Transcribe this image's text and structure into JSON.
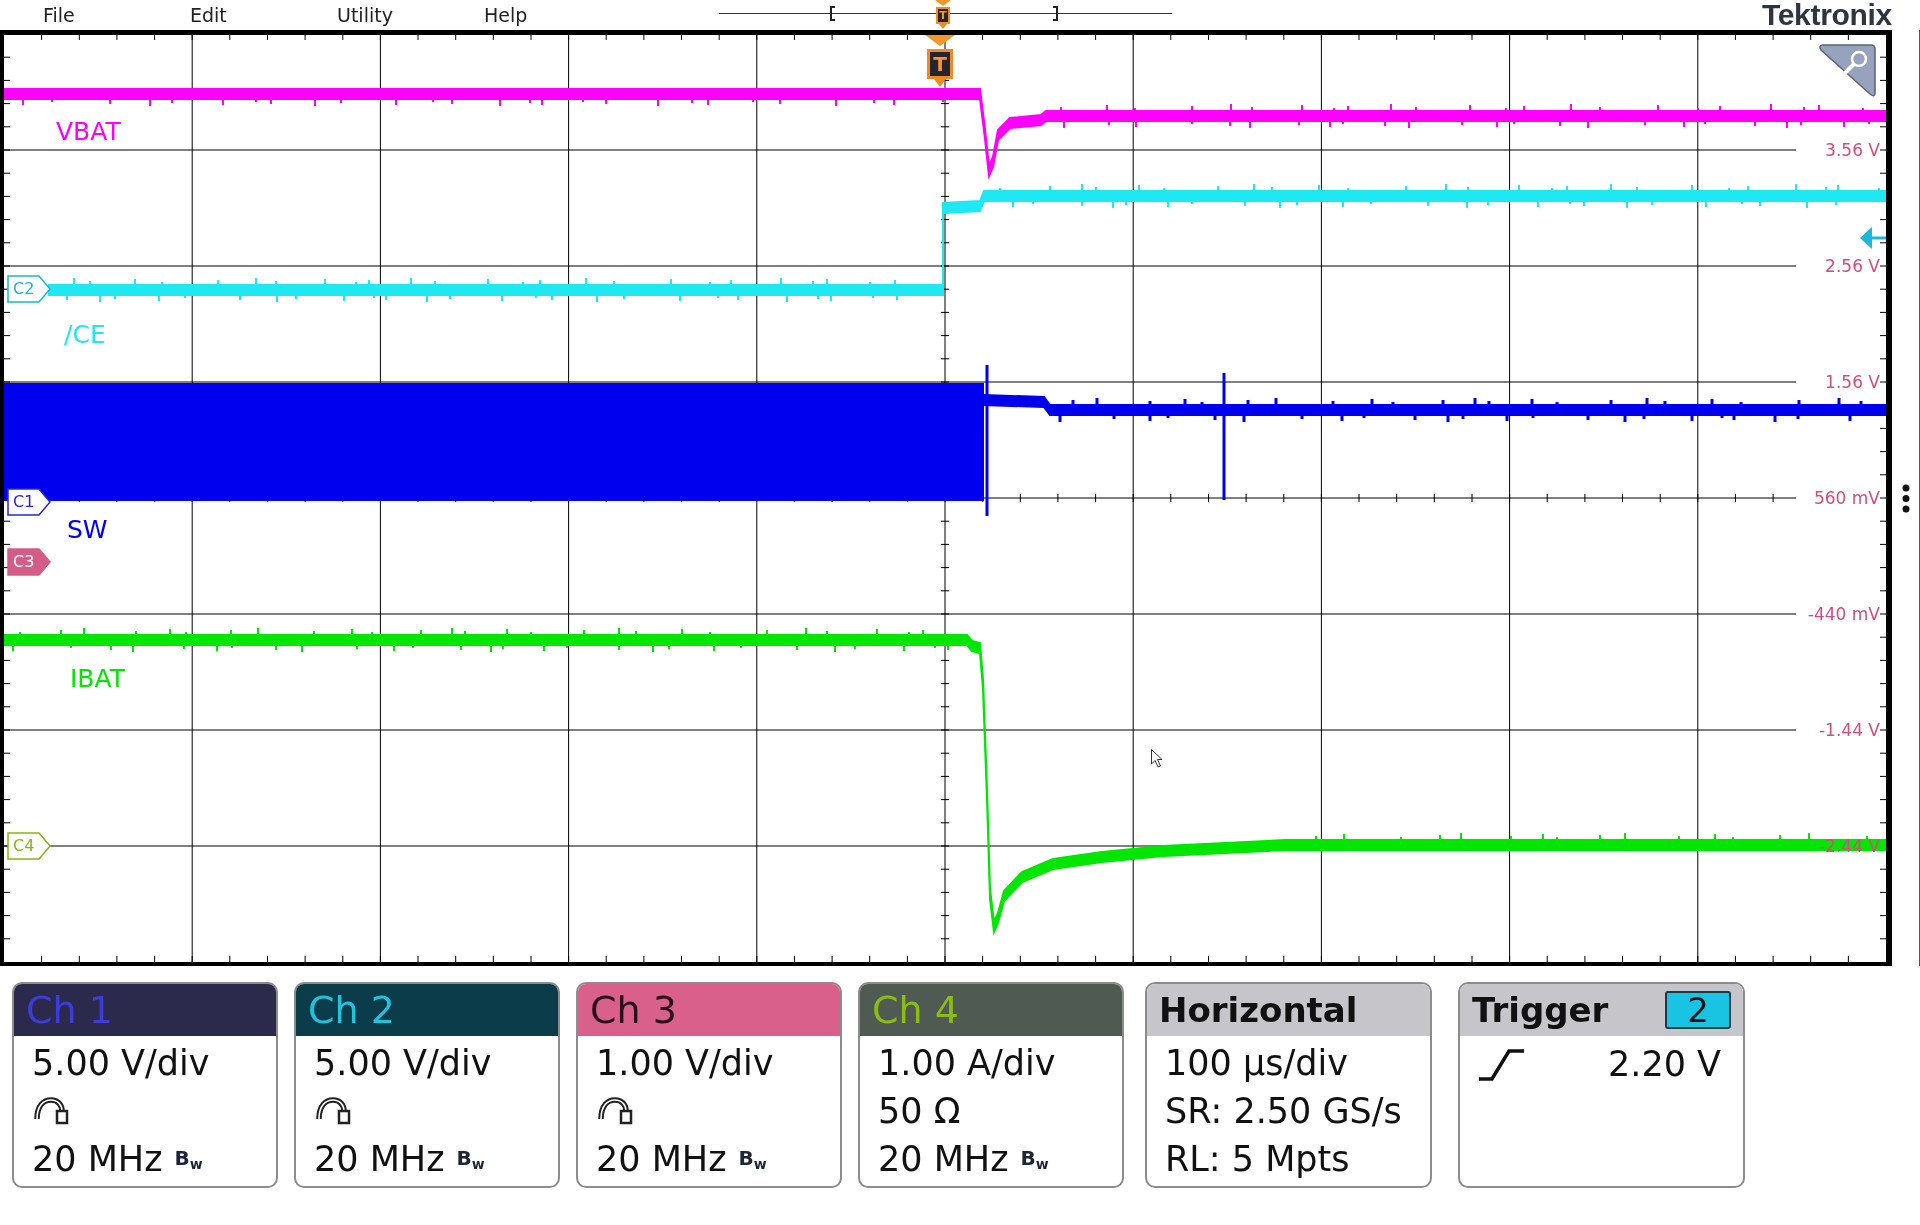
{
  "menu": [
    "File",
    "Edit",
    "Utility",
    "Help"
  ],
  "record_view": {
    "trigger_label": "T"
  },
  "logo": "Tektronix",
  "display": {
    "trigger_label": "T",
    "traces": [
      {
        "label": "VBAT",
        "kind": "sag",
        "color": "#ff00ff"
      },
      {
        "label": "/CE",
        "kind": "rise",
        "color": "#1ee8f2"
      },
      {
        "label": "SW",
        "kind": "burst",
        "color": "#0000ee"
      },
      {
        "label": "IBAT",
        "kind": "dip",
        "color": "#00e600"
      }
    ],
    "channel_markers": [
      {
        "label": "C2",
        "color": "#1cb4d8",
        "selected": false
      },
      {
        "label": "C1",
        "color": "#2828d0",
        "selected": false
      },
      {
        "label": "C3",
        "color": "#d65c88",
        "selected": true
      },
      {
        "label": "C4",
        "color": "#86b41a",
        "selected": false
      }
    ],
    "scale_labels": [
      "3.56 V",
      "2.56 V",
      "1.56 V",
      "560 mV",
      "-440 mV",
      "-1.44 V",
      "-2.44 V"
    ]
  },
  "channels": [
    {
      "label": "Ch 1",
      "color": "#2b2a4c",
      "rows": [
        {
          "kind": "scale",
          "text": "5.00 V/div"
        },
        {
          "kind": "probe"
        },
        {
          "kind": "bandwidth",
          "text": "20 MHz",
          "mark": "B$_{w}$"
        }
      ]
    },
    {
      "label": "Ch 2",
      "color": "#0a3c4a",
      "rows": [
        {
          "kind": "scale",
          "text": "5.00 V/div"
        },
        {
          "kind": "probe"
        },
        {
          "kind": "bandwidth",
          "text": "20 MHz",
          "mark": "B$_{w}$"
        }
      ]
    },
    {
      "label": "Ch 3",
      "color": "#d8608a",
      "rows": [
        {
          "kind": "scale",
          "text": "1.00 V/div"
        },
        {
          "kind": "probe"
        },
        {
          "kind": "bandwidth",
          "text": "20 MHz",
          "mark": "B$_{w}$"
        }
      ]
    },
    {
      "label": "Ch 4",
      "color": "#4f5b52",
      "rows": [
        {
          "kind": "scale",
          "text": "1.00 A/div"
        },
        {
          "kind": "termination",
          "text": "50 Ω"
        },
        {
          "kind": "bandwidth",
          "text": "20 MHz",
          "mark": "B$_{w}$"
        }
      ]
    }
  ],
  "horizontal": {
    "title": "Horizontal",
    "rows": [
      "100 µs/div",
      "SR: 2.50 GS/s",
      "RL: 5 Mpts"
    ]
  },
  "trigger": {
    "title": "Trigger",
    "source": "2",
    "rising_edge": true,
    "value": "2.20 V"
  }
}
